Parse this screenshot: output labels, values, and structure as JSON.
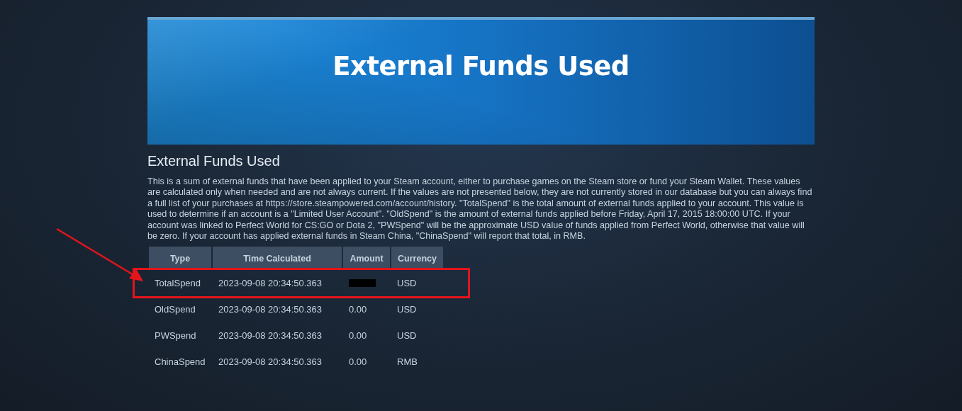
{
  "banner": {
    "title": "External Funds Used"
  },
  "heading": "External Funds Used",
  "description": "This is a sum of external funds that have been applied to your Steam account, either to purchase games on the Steam store or fund your Steam Wallet. These values are calculated only when needed and are not always current. If the values are not presented below, they are not currently stored in our database but you can always find a full list of your purchases at https://store.steampowered.com/account/history. \"TotalSpend\" is the total amount of external funds applied to your account. This value is used to determine if an account is a \"Limited User Account\". \"OldSpend\" is the amount of external funds applied before Friday, April 17, 2015 18:00:00 UTC. If your account was linked to Perfect World for CS:GO or Dota 2, \"PWSpend\" will be the approximate USD value of funds applied from Perfect World, otherwise that value will be zero. If your account has applied external funds in Steam China, \"ChinaSpend\" will report that total, in RMB.",
  "table": {
    "columns": [
      "Type",
      "Time Calculated",
      "Amount",
      "Currency"
    ],
    "rows": [
      {
        "type": "TotalSpend",
        "time": "2023-09-08 20:34:50.363",
        "redacted": true,
        "highlighted": true,
        "currency": "USD"
      },
      {
        "type": "OldSpend",
        "time": "2023-09-08 20:34:50.363",
        "amount": "0.00",
        "redacted": false,
        "highlighted": false,
        "currency": "USD"
      },
      {
        "type": "PWSpend",
        "time": "2023-09-08 20:34:50.363",
        "amount": "0.00",
        "redacted": false,
        "highlighted": false,
        "currency": "USD"
      },
      {
        "type": "ChinaSpend",
        "time": "2023-09-08 20:34:50.363",
        "amount": "0.00",
        "redacted": false,
        "highlighted": false,
        "currency": "RMB"
      }
    ]
  }
}
